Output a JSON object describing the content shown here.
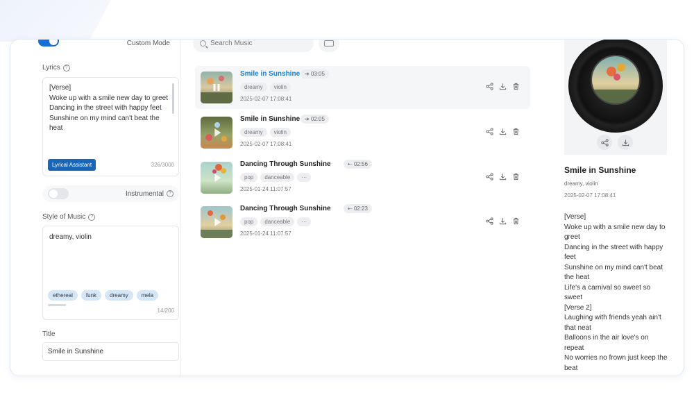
{
  "left_panel": {
    "custom_mode_label": "Custom Mode",
    "custom_mode_on": true,
    "lyrics_label": "Lyrics",
    "lyrics_text": "[Verse]\nWoke up with a smile new day to greet\nDancing in the street with happy feet\nSunshine on my mind can't beat the heat",
    "lyrical_assistant_label": "Lyrical Assistant",
    "lyrics_count": "326/3000",
    "instrumental_label": "Instrumental",
    "instrumental_on": false,
    "style_label": "Style of Music",
    "style_value": "dreamy, violin",
    "style_suggestions": [
      "ethereal",
      "funk",
      "dreamy",
      "mela"
    ],
    "style_count": "14/200",
    "title_label": "Title",
    "title_value": "Smile in Sunshine"
  },
  "search": {
    "placeholder": "Search Music"
  },
  "songs": [
    {
      "title": "Smile in Sunshine",
      "duration": "03:05",
      "tags": [
        "dreamy",
        "violin"
      ],
      "date": "2025-02-07 17:08:41",
      "active": true,
      "playing": true
    },
    {
      "title": "Smile in Sunshine",
      "duration": "02:05",
      "tags": [
        "dreamy",
        "violin"
      ],
      "date": "2025-02-07 17:08:41",
      "active": false,
      "playing": false
    },
    {
      "title": "Dancing Through Sunshine",
      "duration": "02:56",
      "tags": [
        "pop",
        "danceable",
        "···"
      ],
      "date": "2025-01-24 11:07:57",
      "active": false,
      "playing": false
    },
    {
      "title": "Dancing Through Sunshine",
      "duration": "02:23",
      "tags": [
        "pop",
        "danceable",
        "···"
      ],
      "date": "2025-01-24 11:07:57",
      "active": false,
      "playing": false
    }
  ],
  "now_playing": {
    "title": "Smile in Sunshine",
    "tags": "dreamy, violin",
    "date": "2025-02-07 17:08:41",
    "lyrics": "[Verse]\nWoke up with a smile new day to greet\nDancing in the street with happy feet\nSunshine on my mind can't beat the heat\nLife's a carnival so sweet so sweet\n[Verse 2]\nLaughing with friends yeah ain't that neat\nBalloons in the air love's on repeat\nNo worries no frown just keep the beat"
  },
  "colors": {
    "accent": "#1a6fd4",
    "active_title": "#1a7fd0",
    "assistant_button": "#1766b8"
  }
}
